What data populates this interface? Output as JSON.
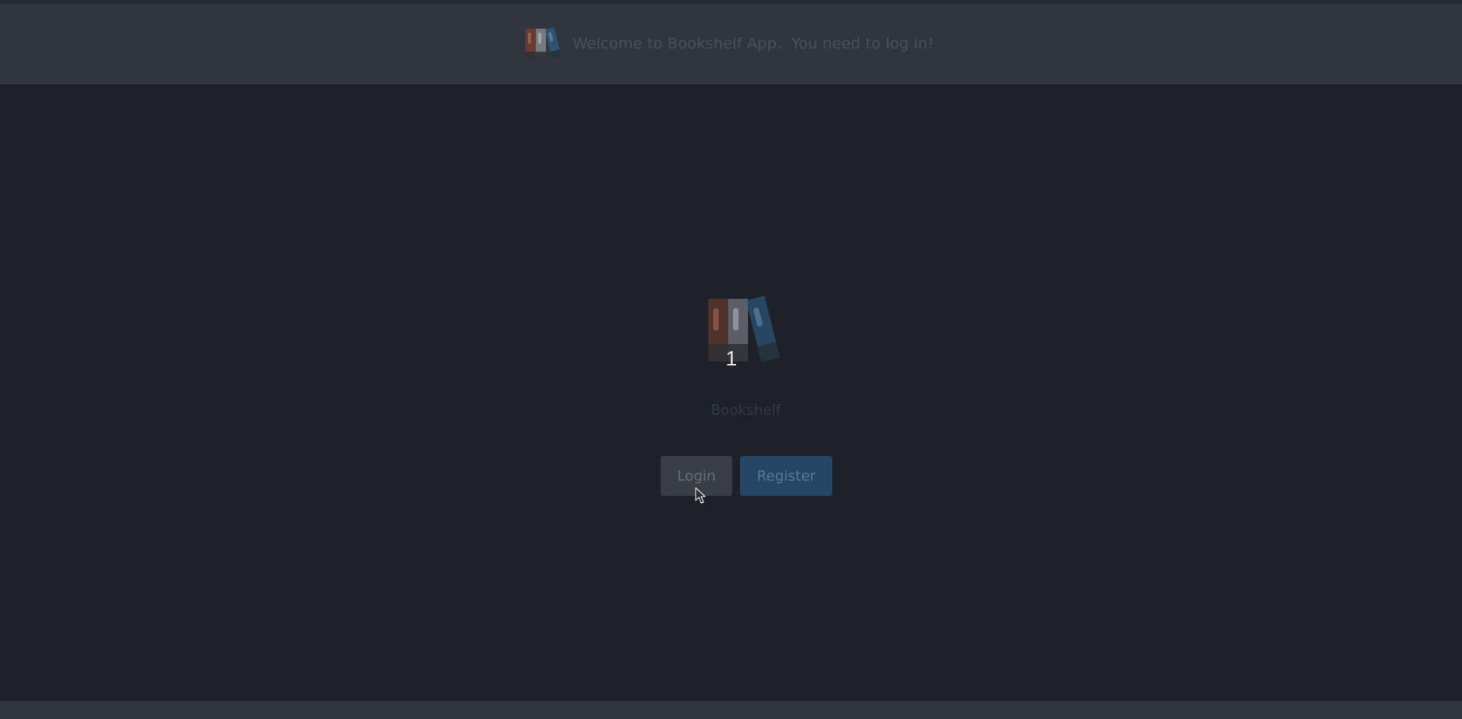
{
  "header": {
    "message": "Welcome to Bookshelf App.  You need to log in!",
    "logo_icon": "bookshelf-logo-icon"
  },
  "hero": {
    "logo_icon": "bookshelf-logo-icon",
    "step_number": "1",
    "app_name": "Bookshelf"
  },
  "actions": {
    "login_label": "Login",
    "register_label": "Register"
  },
  "colors": {
    "background": "#1f2128",
    "header_background": "#31363e",
    "login_button": "#393e45",
    "register_button": "#254664",
    "book_red": "#8a4a37",
    "book_gray": "#9a9ea4",
    "book_blue": "#3a6f9b"
  }
}
